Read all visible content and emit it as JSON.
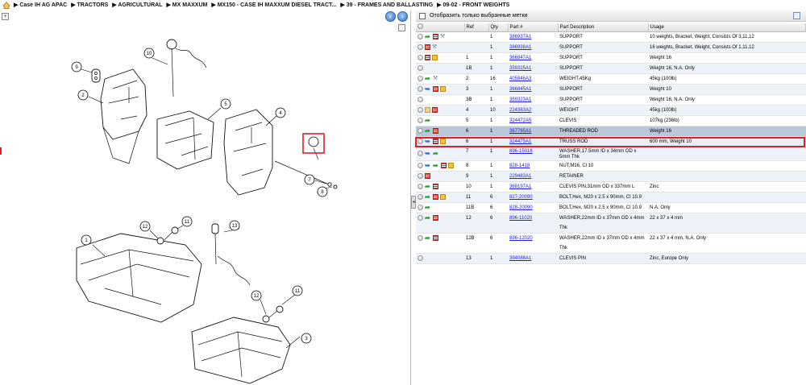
{
  "breadcrumb": [
    "Case IH AG APAC",
    "TRACTORS",
    "AGRICULTURAL",
    "MX MAXXUM",
    "MX150 - CASE IH MAXXUM DIESEL TRACT...",
    "39 - FRAMES AND BALLASTING",
    "09-02 - FRONT WEIGHTS"
  ],
  "filter": {
    "label": "Отобразить только выбранные метки",
    "checked": false
  },
  "table": {
    "columns": [
      "",
      "Ref",
      "Qty",
      "Part #",
      "Part Description",
      "Usage"
    ],
    "rows": [
      {
        "icons": [
          "radio",
          "arrow-green",
          "list",
          "wrench"
        ],
        "ref": "",
        "qty": "1",
        "part": "386937A1",
        "desc": "SUPPORT",
        "usage": "10 weights, Bracket, Weight, Consists Of 3,11,12"
      },
      {
        "icons": [
          "radio",
          "list",
          "wrench"
        ],
        "ref": "",
        "qty": "1",
        "part": "386938A1",
        "desc": "SUPPORT",
        "usage": "16 weights, Bracket, Weight, Consists Of 1,11,12"
      },
      {
        "icons": [
          "radio",
          "list",
          "box"
        ],
        "ref": "1",
        "qty": "1",
        "part": "366847A1",
        "desc": "SUPPORT",
        "usage": "Weight 16"
      },
      {
        "icons": [
          "radio"
        ],
        "ref": "1B",
        "qty": "1",
        "part": "359325A1",
        "desc": "SUPPORT",
        "usage": "Weight 16, N.A. Only"
      },
      {
        "icons": [
          "radio",
          "arrow-green",
          "wrench"
        ],
        "ref": "2",
        "qty": "16",
        "part": "405846A3",
        "desc": "WEIGHT,45Kg",
        "usage": "45kg (100lb)"
      },
      {
        "icons": [
          "radio",
          "arrow-blue",
          "list",
          "box"
        ],
        "ref": "3",
        "qty": "1",
        "part": "366845A1",
        "desc": "SUPPORT",
        "usage": "Weight 10"
      },
      {
        "icons": [
          "radio"
        ],
        "ref": "3B",
        "qty": "1",
        "part": "359323A1",
        "desc": "SUPPORT",
        "usage": "Weight 16, N.A. Only"
      },
      {
        "icons": [
          "radio",
          "yellow",
          "list"
        ],
        "ref": "4",
        "qty": "10",
        "part": "224383A2",
        "desc": "WEIGHT",
        "usage": "45kg (100lb)"
      },
      {
        "icons": [
          "radio",
          "arrow-green"
        ],
        "ref": "5",
        "qty": "1",
        "part": "324472A5",
        "desc": "CLEVIS",
        "usage": "107kg (236lb)"
      },
      {
        "icons": [
          "radio",
          "arrow-green",
          "list"
        ],
        "ref": "6",
        "qty": "1",
        "part": "367765A1",
        "desc": "THREADED ROD",
        "usage": "Weight 16",
        "state": "highlight"
      },
      {
        "icons": [
          "radio",
          "arrow-blue",
          "list",
          "box"
        ],
        "ref": "6",
        "qty": "1",
        "part": "324475A1",
        "desc": "TRUSS ROD",
        "usage": "600 mm, Weight 10",
        "state": "selected"
      },
      {
        "icons": [
          "radio",
          "arrow-blue",
          "arrow-green"
        ],
        "ref": "7",
        "qty": "1",
        "part": "896-15016",
        "desc": "WASHER,17.5mm ID x 34mm OD x 5mm Thk",
        "usage": "",
        "tall": true
      },
      {
        "icons": [
          "radio",
          "arrow-blue",
          "arrow-green",
          "list",
          "box"
        ],
        "ref": "8",
        "qty": "1",
        "part": "828-1418",
        "desc": "NUT,M16, Cl 10",
        "usage": ""
      },
      {
        "icons": [
          "radio",
          "list"
        ],
        "ref": "9",
        "qty": "1",
        "part": "229483A1",
        "desc": "RETAINER",
        "usage": ""
      },
      {
        "icons": [
          "radio",
          "arrow-green",
          "list"
        ],
        "ref": "10",
        "qty": "1",
        "part": "368197A1",
        "desc": "CLEVIS PIN,31mm OD x 337mm L",
        "usage": "Zinc"
      },
      {
        "icons": [
          "radio",
          "arrow-green",
          "list",
          "box"
        ],
        "ref": "11",
        "qty": "6",
        "part": "827-20090",
        "desc": "BOLT,Hex, M20 x 2.5 x 90mm, Cl 10.9",
        "usage": ""
      },
      {
        "icons": [
          "radio",
          "arrow-green"
        ],
        "ref": "11B",
        "qty": "6",
        "part": "828-20090",
        "desc": "BOLT,Hex, M20 x 2.5 x 90mm, Cl 10.9",
        "usage": "N.A. Only"
      },
      {
        "icons": [
          "radio",
          "arrow-green",
          "list"
        ],
        "ref": "12",
        "qty": "6",
        "part": "896-11020",
        "desc": "WASHER,22mm ID x 37mm OD x 4mm Thk",
        "usage": "22 x 37 x 4 mm"
      },
      {
        "icons": [
          "radio",
          "arrow-green",
          "list"
        ],
        "ref": "12B",
        "qty": "6",
        "part": "896-12020",
        "desc": "WASHER,22mm ID x 37mm OD x 4mm Thk",
        "usage": "22 x 37 x 4 mm, N.A. Only"
      },
      {
        "icons": [
          "radio"
        ],
        "ref": "13",
        "qty": "1",
        "part": "394088A1",
        "desc": "CLEVIS PIN",
        "usage": "Zinc, Europe Only"
      }
    ]
  },
  "diagram": {
    "callouts": [
      "1",
      "2",
      "3",
      "4",
      "5",
      "6",
      "7",
      "8",
      "9",
      "10",
      "11",
      "12",
      "13",
      "11",
      "12"
    ],
    "selected_callout": "6"
  },
  "colors": {
    "link": "#1a1ae0",
    "selection": "#e02020",
    "highlight_row": "#b9c8d8",
    "accent": "#3d7ad0"
  },
  "nav": {
    "back": "‹",
    "forward": "›"
  }
}
